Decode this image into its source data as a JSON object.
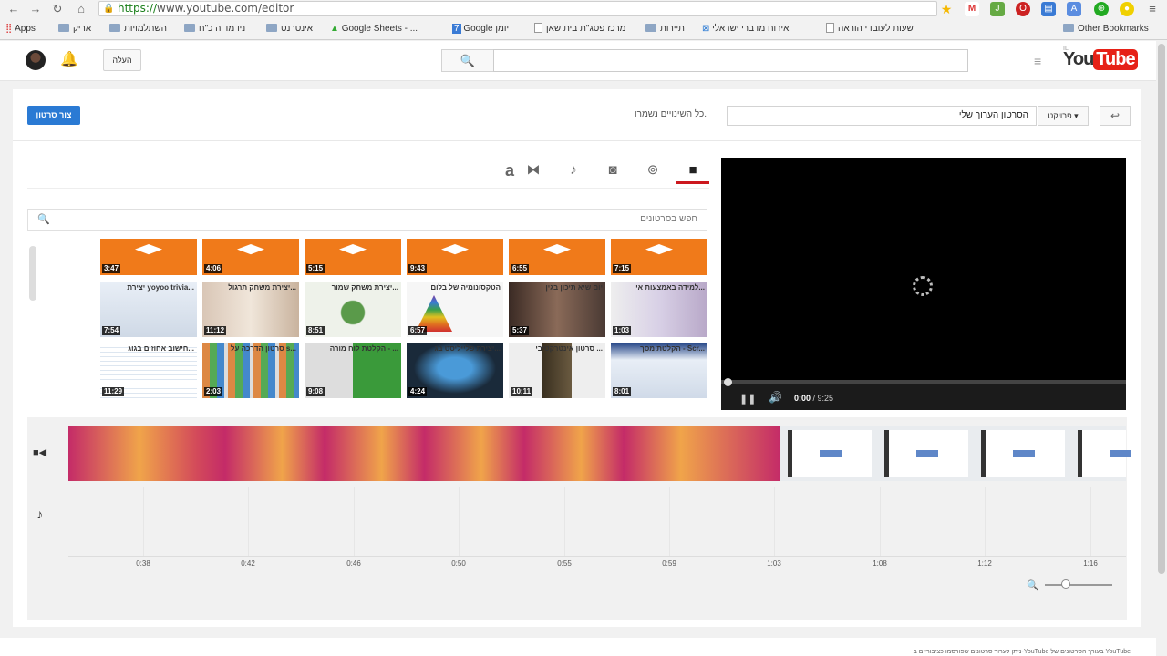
{
  "browser": {
    "url_scheme": "https://",
    "url_rest": "www.youtube.com/editor",
    "bookmarks": [
      "Apps",
      "אריק",
      "השתלמויות",
      "ניו מדיה כ\"ח",
      "אינטרנט",
      "Google Sheets - ...",
      "Google יומן",
      "מרכז פסג\"ת בית שאן",
      "תיירות",
      "אירוח מדברי ישראלי",
      "שעות לעובדי הוראה",
      "Other Bookmarks"
    ]
  },
  "header": {
    "upload_label": "העלה",
    "logo_you": "You",
    "logo_tube": "Tube",
    "logo_region": "IL"
  },
  "editor": {
    "create_label": "צור סרטון",
    "saved_text": "כל השינויים נשמרו.",
    "project_title": "הסרטון הערוך שלי",
    "project_label": "פרויקט ▾",
    "back_label": "↩"
  },
  "tabs": [
    {
      "name": "video",
      "glyph": "■"
    },
    {
      "name": "cc",
      "glyph": "⊚"
    },
    {
      "name": "photo",
      "glyph": "◙"
    },
    {
      "name": "music",
      "glyph": "♪"
    },
    {
      "name": "transition",
      "glyph": "⧓"
    },
    {
      "name": "text",
      "glyph": "a"
    }
  ],
  "library": {
    "search_placeholder": "חפש בסרטונים",
    "row1": [
      "3:47",
      "4:06",
      "5:15",
      "9:43",
      "6:55",
      "7:15"
    ],
    "row2": [
      {
        "cap": "יצירת yoyoo trivia...",
        "dur": "7:54"
      },
      {
        "cap": "יצירת משחק תרגול...",
        "dur": "11:12"
      },
      {
        "cap": "יצירת משחק שמור...",
        "dur": "8:51"
      },
      {
        "cap": "הטקסונומיה של בלום",
        "dur": "6:57"
      },
      {
        "cap": "יום שיא תיכון בגין",
        "dur": "5:37"
      },
      {
        "cap": "למידה באמצעות אי...",
        "dur": "1:03"
      }
    ],
    "row3": [
      {
        "cap": "חישוב אחוזים בגוג...",
        "dur": "11:29"
      },
      {
        "cap": "סרטון הדרכה על s...",
        "dur": "2:03"
      },
      {
        "cap": "הקלטת לוח מורה - ...",
        "dur": "9:08"
      },
      {
        "cap": "יצירת פלייליסט בג...",
        "dur": "4:24"
      },
      {
        "cap": "סרטון אינטרקטיבי ...",
        "dur": "10:11"
      },
      {
        "cap": "הקלטת מסך - Scr...",
        "dur": "8:01"
      }
    ]
  },
  "player": {
    "time_current": "0:00",
    "time_total": " / 9:25"
  },
  "timeline": {
    "ticks": [
      "0:38",
      "0:42",
      "0:46",
      "0:50",
      "0:55",
      "0:59",
      "1:03",
      "1:08",
      "1:12",
      "1:16"
    ]
  },
  "footer": {
    "text": "ניתן לערוך סרטונים שפורסמו כציבוריים ב-YouTube בעורך הסרטונים של YouTube"
  }
}
